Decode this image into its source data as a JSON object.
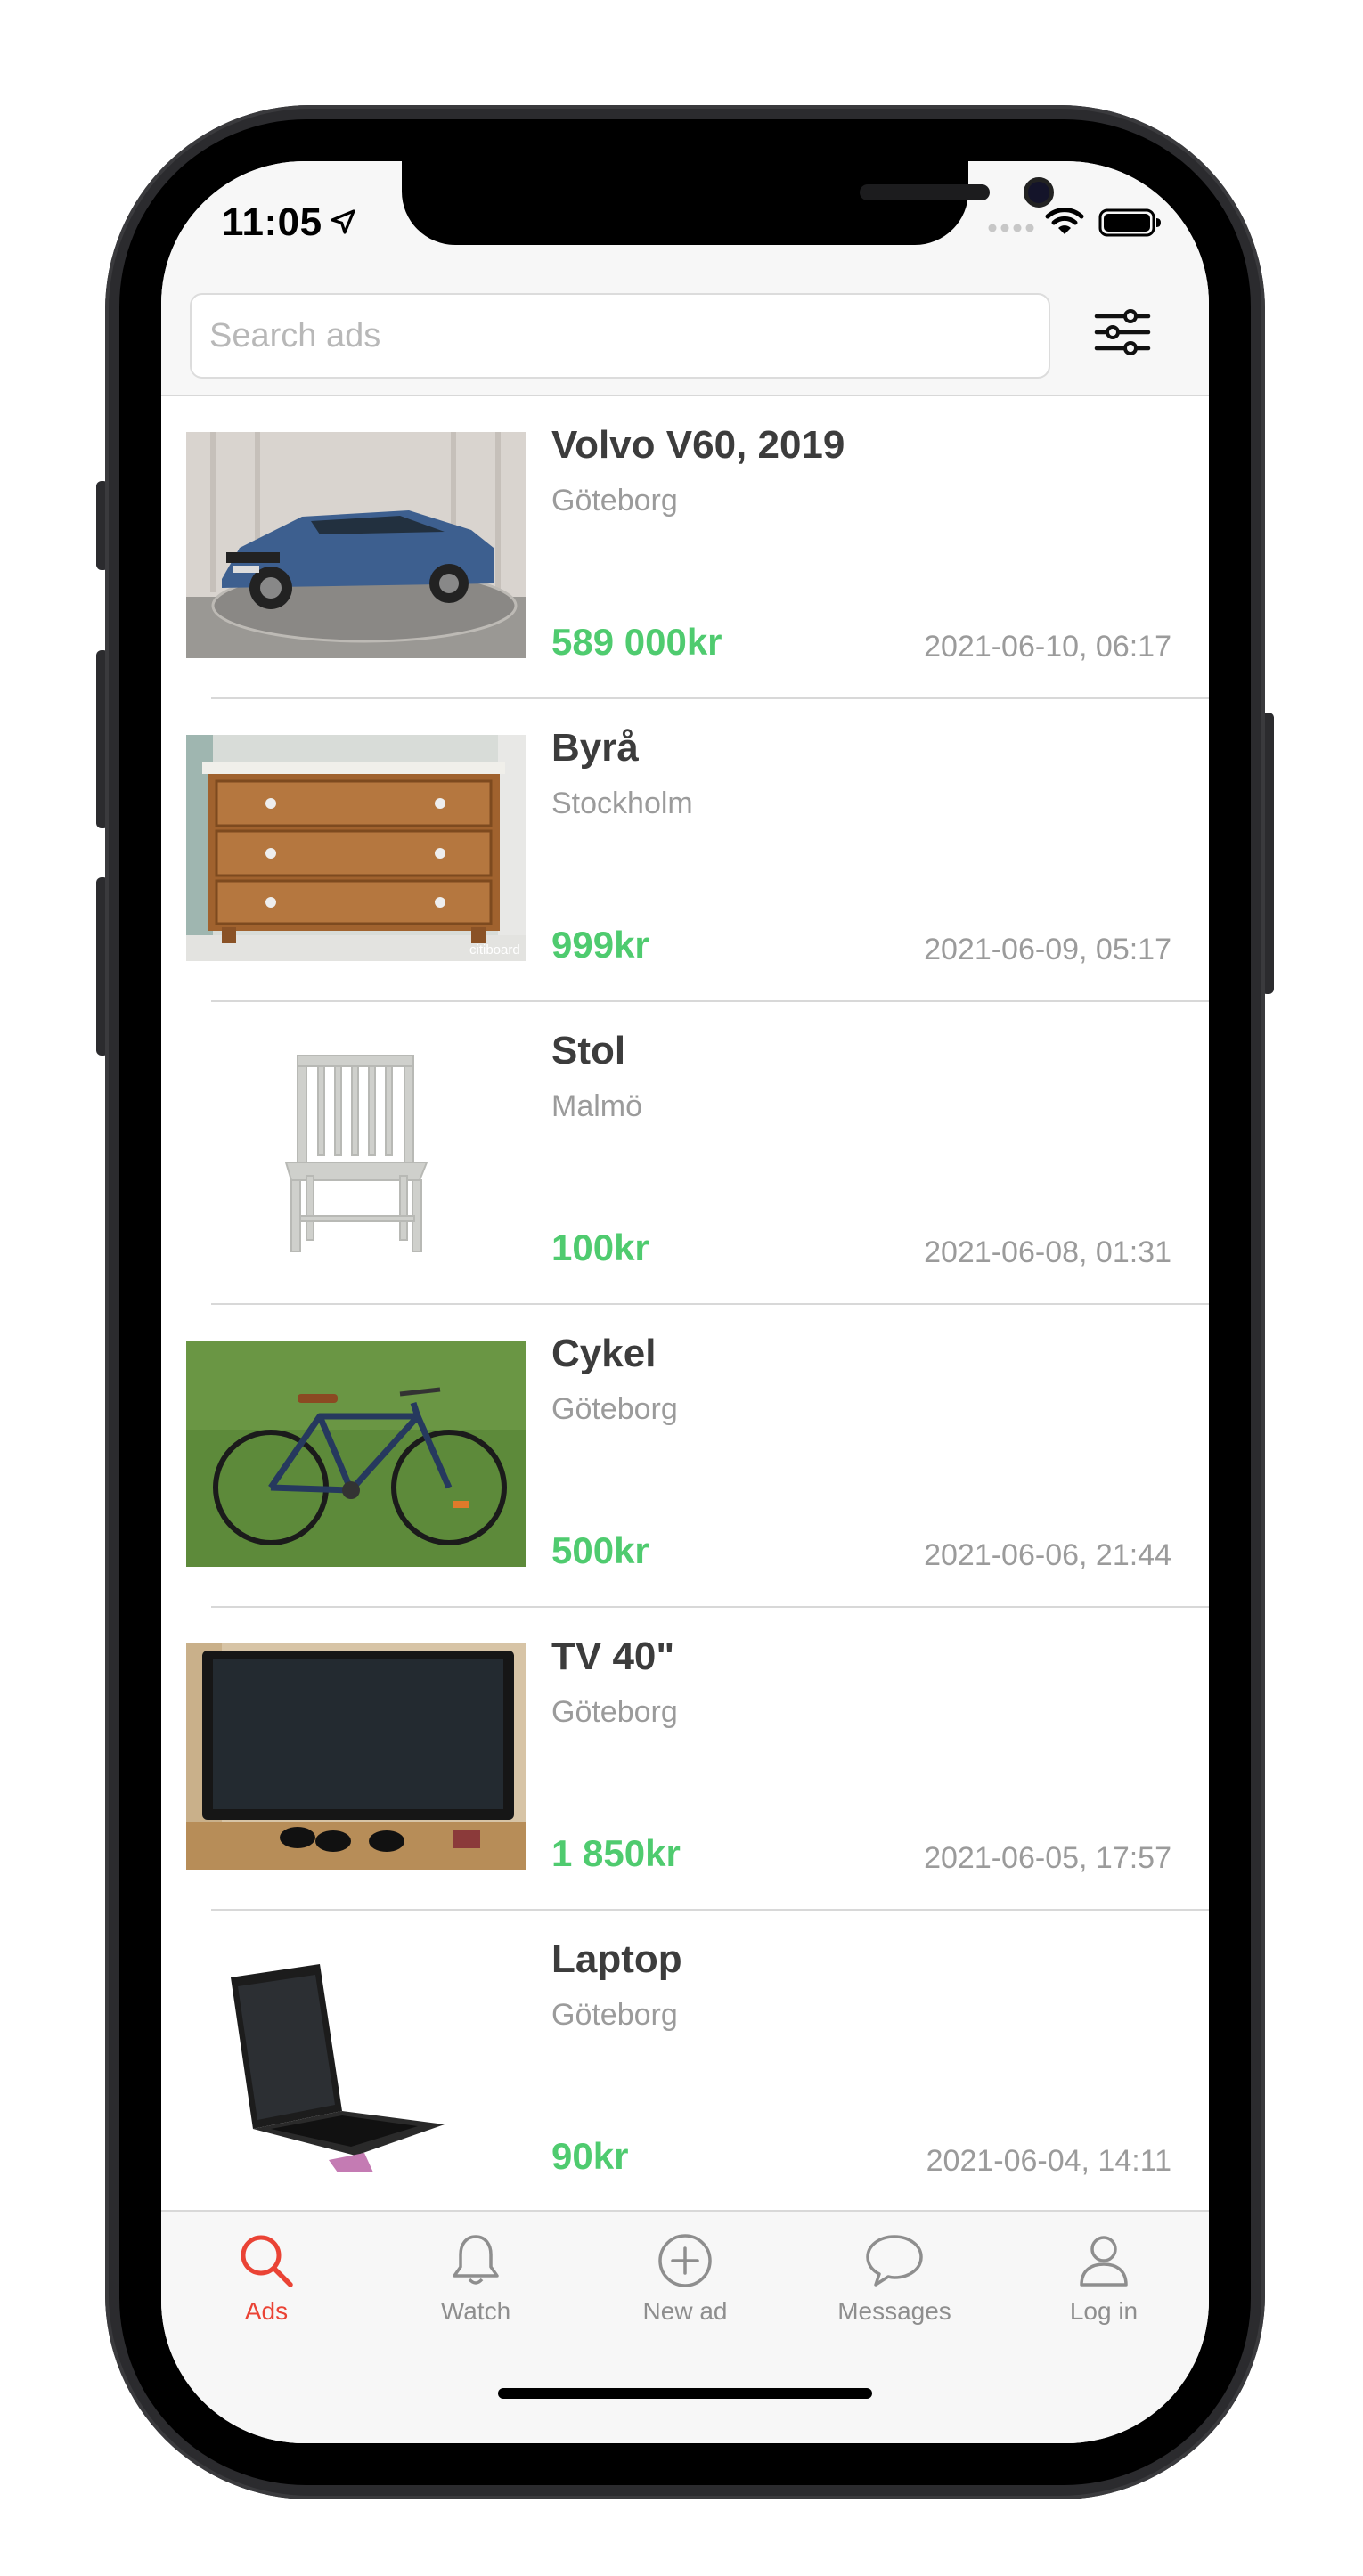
{
  "status_bar": {
    "time": "11:05",
    "icons": [
      "location-arrow-icon",
      "signal-icon",
      "wifi-icon",
      "battery-icon"
    ]
  },
  "search": {
    "placeholder": "Search ads",
    "value": ""
  },
  "colors": {
    "price": "#4fcb6f",
    "active_tab": "#ea4335",
    "inactive_tab": "#8e8e8e",
    "title": "#3c3c3c",
    "secondary_text": "#9b9b9b"
  },
  "ads": [
    {
      "title": "Volvo V60, 2019",
      "city": "Göteborg",
      "price": "589 000kr",
      "date": "2021-06-10, 06:17"
    },
    {
      "title": "Byrå",
      "city": "Stockholm",
      "price": "999kr",
      "date": "2021-06-09, 05:17",
      "image_watermark": "citiboard"
    },
    {
      "title": "Stol",
      "city": "Malmö",
      "price": "100kr",
      "date": "2021-06-08, 01:31"
    },
    {
      "title": "Cykel",
      "city": "Göteborg",
      "price": "500kr",
      "date": "2021-06-06, 21:44"
    },
    {
      "title": "TV 40\"",
      "city": "Göteborg",
      "price": "1 850kr",
      "date": "2021-06-05, 17:57"
    },
    {
      "title": "Laptop",
      "city": "Göteborg",
      "price": "90kr",
      "date": "2021-06-04, 14:11"
    }
  ],
  "tabs": [
    {
      "label": "Ads",
      "icon": "search-icon",
      "active": true
    },
    {
      "label": "Watch",
      "icon": "bell-icon",
      "active": false
    },
    {
      "label": "New ad",
      "icon": "plus-circle-icon",
      "active": false
    },
    {
      "label": "Messages",
      "icon": "chat-bubble-icon",
      "active": false
    },
    {
      "label": "Log in",
      "icon": "person-icon",
      "active": false
    }
  ]
}
